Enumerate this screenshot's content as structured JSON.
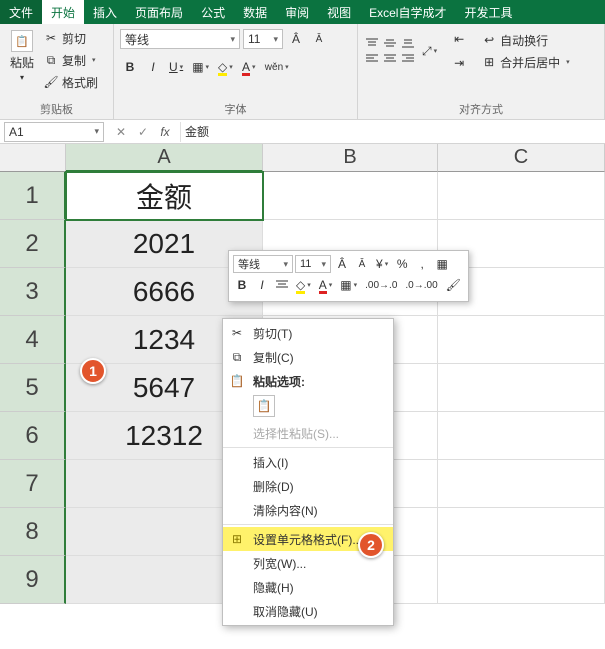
{
  "tabs": {
    "file": "文件",
    "home": "开始",
    "insert": "插入",
    "layout": "页面布局",
    "formula": "公式",
    "data": "数据",
    "review": "审阅",
    "view": "视图",
    "addin": "Excel自学成才",
    "dev": "开发工具"
  },
  "ribbon": {
    "clipboard": {
      "label": "剪贴板",
      "paste": "粘贴",
      "cut": "剪切",
      "copy": "复制",
      "painter": "格式刷"
    },
    "font": {
      "label": "字体",
      "name": "等线",
      "size": "11"
    },
    "align": {
      "label": "对齐方式",
      "wrap": "自动换行",
      "merge": "合并后居中"
    }
  },
  "fx": {
    "ref": "A1",
    "value": "金额"
  },
  "cols": {
    "a": "A",
    "b": "B",
    "c": "C"
  },
  "rows": [
    "1",
    "2",
    "3",
    "4",
    "5",
    "6",
    "7",
    "8",
    "9"
  ],
  "data_a": [
    "金额",
    "2021",
    "6666",
    "1234",
    "5647",
    "12312",
    "",
    "",
    ""
  ],
  "mini": {
    "font": "等线",
    "size": "11"
  },
  "ctx": {
    "cut": "剪切(T)",
    "copy": "复制(C)",
    "paste_opt": "粘贴选项:",
    "paste_special": "选择性粘贴(S)...",
    "insert": "插入(I)",
    "delete": "删除(D)",
    "clear": "清除内容(N)",
    "format": "设置单元格格式(F)...",
    "colwidth": "列宽(W)...",
    "hide": "隐藏(H)",
    "unhide": "取消隐藏(U)"
  },
  "ann": {
    "one": "1",
    "two": "2"
  }
}
